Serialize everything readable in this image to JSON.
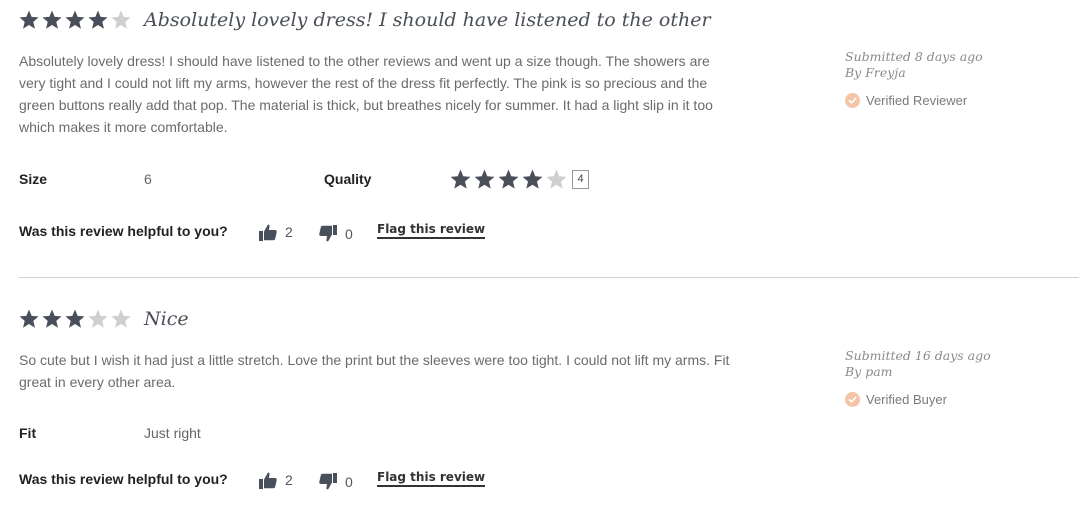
{
  "reviews": [
    {
      "rating": 4,
      "title": "Absolutely lovely dress! I should have listened to the other",
      "body": "Absolutely lovely dress! I should have listened to the other reviews and went up a size though. The showers are very tight and I could not lift my arms, however the rest of the dress fit perfectly. The pink is so precious and the green buttons really add that pop. The material is thick, but breathes nicely for summer. It had a light slip in it too which makes it more comfortable.",
      "submitted": "Submitted 8 days ago",
      "by": "By Freyja",
      "badge": "Verified Reviewer",
      "attr1_label": "Size",
      "attr1_value": "6",
      "attr2_label": "Quality",
      "quality_rating": 4,
      "quality_value": "4",
      "helpful_label": "Was this review helpful to you?",
      "up_count": "2",
      "down_count": "0",
      "flag_label": "Flag this review"
    },
    {
      "rating": 3,
      "title": "Nice",
      "body": "So cute but I wish it had just a little stretch. Love the print but the sleeves were too tight. I could not lift my arms. Fit great in every other area.",
      "submitted": "Submitted 16 days ago",
      "by": "By pam",
      "badge": "Verified Buyer",
      "attr1_label": "Fit",
      "attr1_value": "Just right",
      "helpful_label": "Was this review helpful to you?",
      "up_count": "2",
      "down_count": "0",
      "flag_label": "Flag this review"
    }
  ],
  "colors": {
    "star_filled": "#4a505b",
    "star_empty": "#cfcfcf",
    "verified_check": "#f3c4a7",
    "divider": "#d0d0d0"
  },
  "icons": {
    "thumbs_up": "thumbs-up-icon",
    "thumbs_down": "thumbs-down-icon",
    "check": "check-icon",
    "star": "star-icon"
  }
}
